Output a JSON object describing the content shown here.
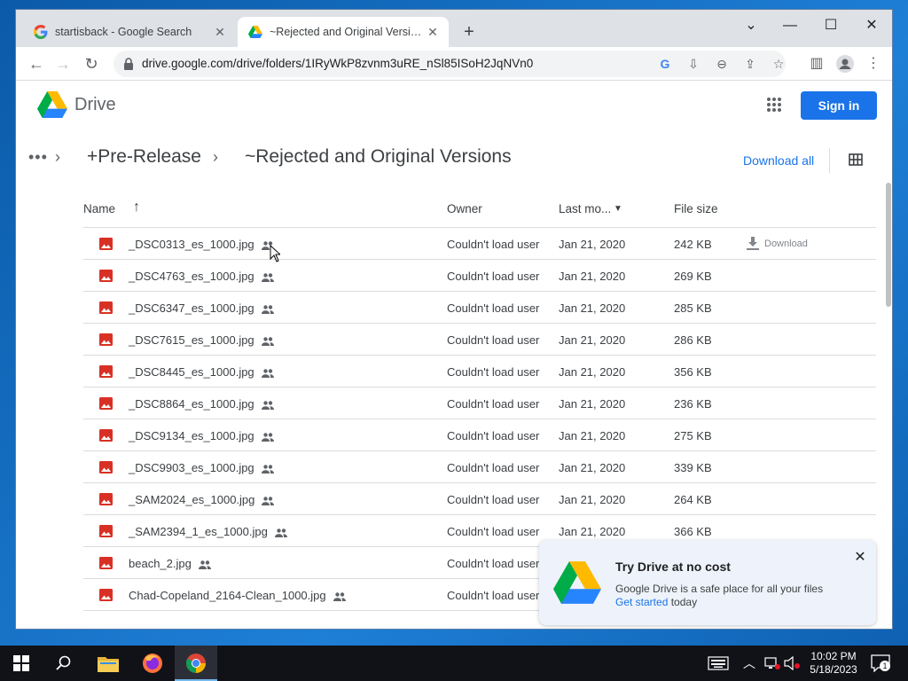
{
  "browser": {
    "tabs": [
      {
        "title": "startisback - Google Search",
        "active": false
      },
      {
        "title": "~Rejected and Original Versions",
        "active": true
      }
    ],
    "url": "drive.google.com/drive/folders/1IRyWkP8zvnm3uRE_nSl85ISoH2JqNVn0"
  },
  "drive": {
    "app_name": "Drive",
    "sign_in_label": "Sign in",
    "breadcrumbs": [
      "+Pre-Release",
      "~Rejected and Original Versions"
    ],
    "download_all_label": "Download all",
    "columns": {
      "name": "Name",
      "owner": "Owner",
      "modified": "Last mo...",
      "size": "File size"
    },
    "download_label": "Download",
    "files": [
      {
        "name": "_DSC0313_es_1000.jpg",
        "owner": "Couldn't load user",
        "modified": "Jan 21, 2020",
        "size": "242 KB"
      },
      {
        "name": "_DSC4763_es_1000.jpg",
        "owner": "Couldn't load user",
        "modified": "Jan 21, 2020",
        "size": "269 KB"
      },
      {
        "name": "_DSC6347_es_1000.jpg",
        "owner": "Couldn't load user",
        "modified": "Jan 21, 2020",
        "size": "285 KB"
      },
      {
        "name": "_DSC7615_es_1000.jpg",
        "owner": "Couldn't load user",
        "modified": "Jan 21, 2020",
        "size": "286 KB"
      },
      {
        "name": "_DSC8445_es_1000.jpg",
        "owner": "Couldn't load user",
        "modified": "Jan 21, 2020",
        "size": "356 KB"
      },
      {
        "name": "_DSC8864_es_1000.jpg",
        "owner": "Couldn't load user",
        "modified": "Jan 21, 2020",
        "size": "236 KB"
      },
      {
        "name": "_DSC9134_es_1000.jpg",
        "owner": "Couldn't load user",
        "modified": "Jan 21, 2020",
        "size": "275 KB"
      },
      {
        "name": "_DSC9903_es_1000.jpg",
        "owner": "Couldn't load user",
        "modified": "Jan 21, 2020",
        "size": "339 KB"
      },
      {
        "name": "_SAM2024_es_1000.jpg",
        "owner": "Couldn't load user",
        "modified": "Jan 21, 2020",
        "size": "264 KB"
      },
      {
        "name": "_SAM2394_1_es_1000.jpg",
        "owner": "Couldn't load user",
        "modified": "Jan 21, 2020",
        "size": "366 KB"
      },
      {
        "name": "beach_2.jpg",
        "owner": "Couldn't load user"
      },
      {
        "name": "Chad-Copeland_2164-Clean_1000.jpg",
        "owner": "Couldn't load user"
      }
    ],
    "promo": {
      "title": "Try Drive at no cost",
      "text": "Google Drive is a safe place for all your files",
      "link": "Get started",
      "link_suffix": " today"
    }
  },
  "taskbar": {
    "time": "10:02 PM",
    "date": "5/18/2023",
    "notification_count": "1"
  },
  "colors": {
    "accent": "#1a73e8",
    "image_icon": "#d93025",
    "taskbar": "#101218"
  }
}
